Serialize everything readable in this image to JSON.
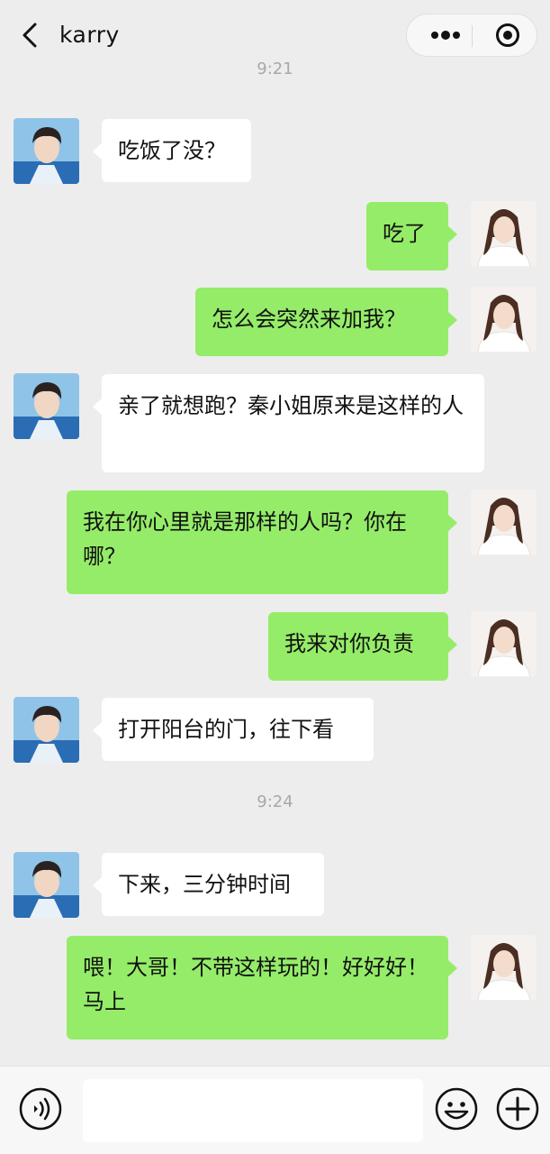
{
  "header": {
    "title": "karry"
  },
  "times": [
    "9:21",
    "9:24"
  ],
  "messages": [
    {
      "side": "left",
      "text": "吃饭了没？"
    },
    {
      "side": "right",
      "text": "吃了"
    },
    {
      "side": "right",
      "text": "怎么会突然来加我？"
    },
    {
      "side": "left",
      "text": "亲了就想跑？秦小姐原来是这样的人"
    },
    {
      "side": "right",
      "text": "我在你心里就是那样的人吗？你在哪？"
    },
    {
      "side": "right",
      "text": "我来对你负责"
    },
    {
      "side": "left",
      "text": "打开阳台的门，往下看"
    },
    {
      "side": "left",
      "text": "下来，三分钟时间"
    },
    {
      "side": "right",
      "text": "喂！大哥！不带这样玩的！好好好！马上"
    }
  ],
  "input": {
    "value": "",
    "placeholder": ""
  },
  "icons": {
    "back": "chevron-left-icon",
    "more": "more-dots-icon",
    "close": "target-circle-icon",
    "voice": "voice-icon",
    "emoji": "emoji-icon",
    "plus": "plus-icon"
  },
  "colors": {
    "background": "#ededed",
    "green_bubble": "#95ec69",
    "white_bubble": "#ffffff"
  }
}
